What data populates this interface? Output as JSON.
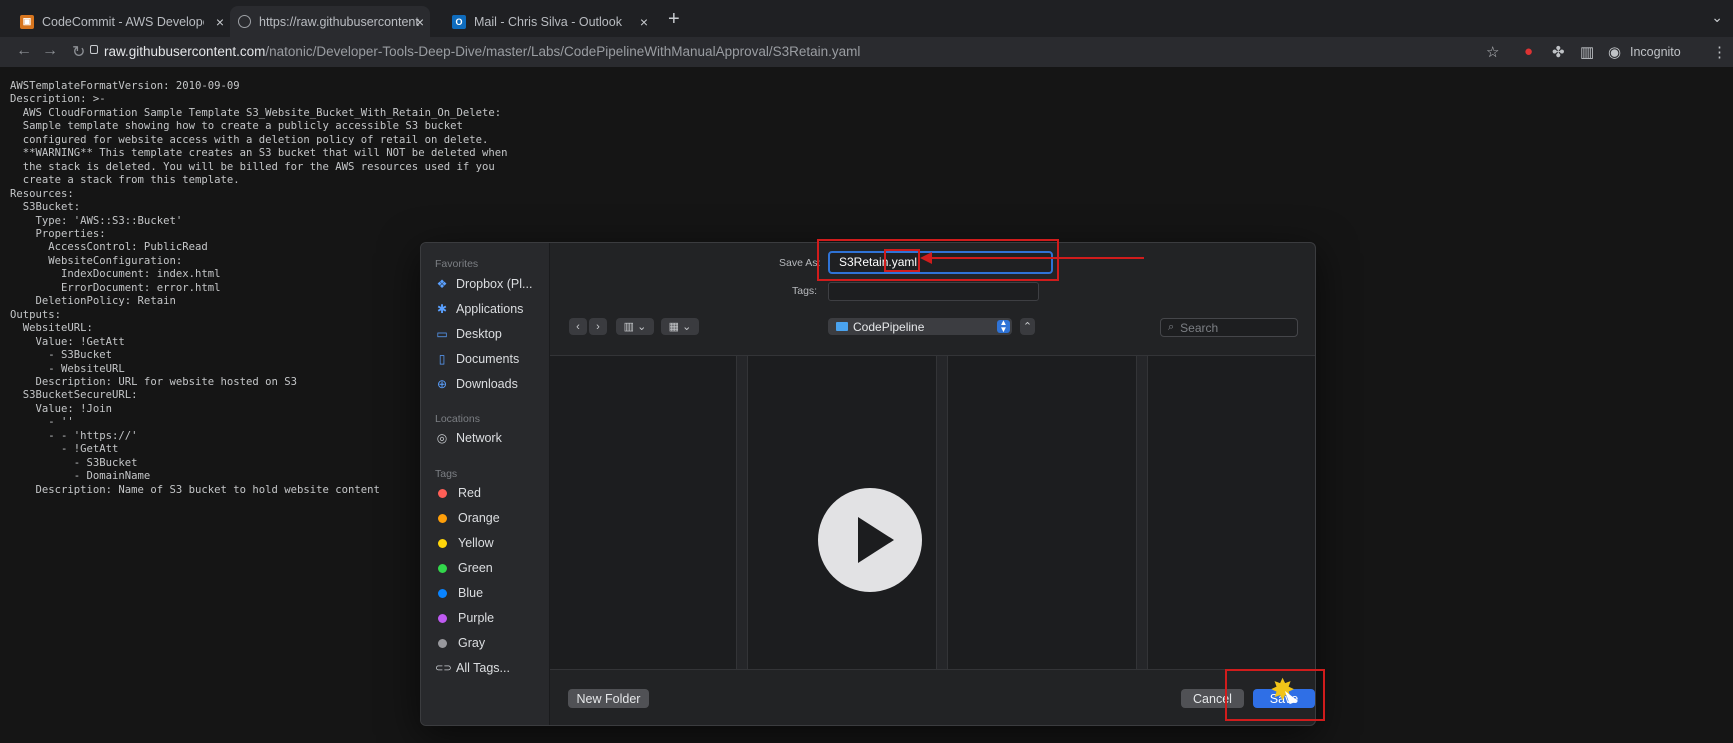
{
  "tabs": [
    {
      "title": "CodeCommit - AWS Developer",
      "favicon": "aws-icon",
      "close": "×",
      "active": false
    },
    {
      "title": "https://raw.githubusercontent.co",
      "favicon": "globe-icon",
      "close": "×",
      "active": true
    },
    {
      "title": "Mail - Chris Silva - Outlook",
      "favicon": "outlook-icon",
      "close": "×",
      "active": false
    }
  ],
  "newtab": "+",
  "address": {
    "host": "raw.githubusercontent.com",
    "path": "/natonic/Developer-Tools-Deep-Dive/master/Labs/CodePipelineWithManualApproval/S3Retain.yaml"
  },
  "browser": {
    "incognito_label": "Incognito"
  },
  "yaml_source": "AWSTemplateFormatVersion: 2010-09-09\nDescription: >-\n  AWS CloudFormation Sample Template S3_Website_Bucket_With_Retain_On_Delete:\n  Sample template showing how to create a publicly accessible S3 bucket\n  configured for website access with a deletion policy of retail on delete.\n  **WARNING** This template creates an S3 bucket that will NOT be deleted when\n  the stack is deleted. You will be billed for the AWS resources used if you\n  create a stack from this template.\nResources:\n  S3Bucket:\n    Type: 'AWS::S3::Bucket'\n    Properties:\n      AccessControl: PublicRead\n      WebsiteConfiguration:\n        IndexDocument: index.html\n        ErrorDocument: error.html\n    DeletionPolicy: Retain\nOutputs:\n  WebsiteURL:\n    Value: !GetAtt\n      - S3Bucket\n      - WebsiteURL\n    Description: URL for website hosted on S3\n  S3BucketSecureURL:\n    Value: !Join\n      - ''\n      - - 'https://'\n        - !GetAtt\n          - S3Bucket\n          - DomainName\n    Description: Name of S3 bucket to hold website content",
  "dialog": {
    "sidebar": {
      "favorites_header": "Favorites",
      "favorites": [
        {
          "label": "Dropbox (Pl...",
          "icon": "dropbox-icon"
        },
        {
          "label": "Applications",
          "icon": "applications-icon"
        },
        {
          "label": "Desktop",
          "icon": "desktop-icon"
        },
        {
          "label": "Documents",
          "icon": "documents-icon"
        },
        {
          "label": "Downloads",
          "icon": "downloads-icon"
        }
      ],
      "locations_header": "Locations",
      "locations": [
        {
          "label": "Network",
          "icon": "network-icon"
        }
      ],
      "tags_header": "Tags",
      "tags": [
        {
          "label": "Red",
          "color": "#ff5f57"
        },
        {
          "label": "Orange",
          "color": "#ff9f0a"
        },
        {
          "label": "Yellow",
          "color": "#ffd60a"
        },
        {
          "label": "Green",
          "color": "#32d74b"
        },
        {
          "label": "Blue",
          "color": "#0a84ff"
        },
        {
          "label": "Purple",
          "color": "#bf5af2"
        },
        {
          "label": "Gray",
          "color": "#98989d"
        }
      ],
      "all_tags": "All Tags..."
    },
    "save_as_label": "Save As:",
    "save_as_value": "S3Retain.yaml",
    "tags_label": "Tags:",
    "location": "CodePipeline",
    "search_placeholder": "Search",
    "new_folder": "New Folder",
    "cancel": "Cancel",
    "save": "Save"
  },
  "colors": {
    "accent": "#2f6fe6",
    "annotation_red": "#d01c1c"
  }
}
